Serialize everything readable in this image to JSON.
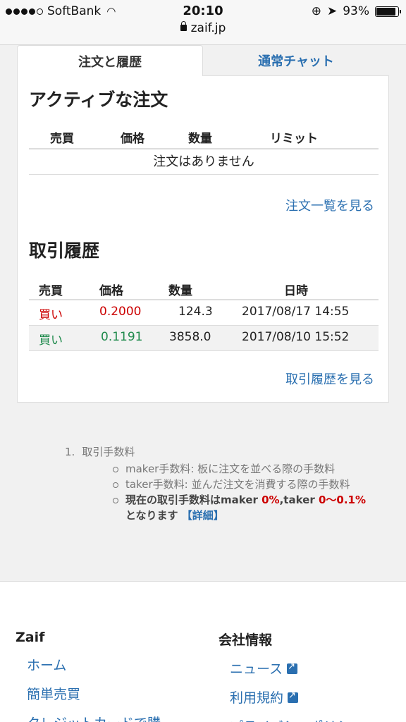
{
  "status": {
    "carrier": "SoftBank",
    "time": "20:10",
    "battery": "93%",
    "url": "zaif.jp"
  },
  "tabs": [
    {
      "label": "注文と履歴"
    },
    {
      "label": "通常チャット"
    }
  ],
  "active_orders": {
    "title": "アクティブな注文",
    "headers": [
      "売買",
      "価格",
      "数量",
      "リミット"
    ],
    "empty": "注文はありません",
    "link": "注文一覧を見る"
  },
  "history": {
    "title": "取引履歴",
    "headers": [
      "売買",
      "価格",
      "数量",
      "日時"
    ],
    "rows": [
      {
        "side": "買い",
        "price": "0.2000",
        "qty": "124.3",
        "datetime": "2017/08/17 14:55"
      },
      {
        "side": "買い",
        "price": "0.1191",
        "qty": "3858.0",
        "datetime": "2017/08/10 15:52"
      }
    ],
    "link": "取引履歴を見る"
  },
  "notes": {
    "num": "1.",
    "title": "取引手数料",
    "maker": "maker手数料: 板に注文を並べる際の手数料",
    "taker": "taker手数料: 並んだ注文を消費する際の手数料",
    "current_a": "現在の取引手数料はmaker ",
    "maker_rate": "0%",
    "current_b": ",taker ",
    "taker_rate": "0〜0.1%",
    "current_c": "となります ",
    "detail": "【詳細】"
  },
  "footer": {
    "col1": {
      "title": "Zaif",
      "links": [
        "ホーム",
        "簡単売買",
        "クレジットカードで購"
      ]
    },
    "col2": {
      "title": "会社情報",
      "links": [
        "ニュース",
        "利用規約",
        "プライバシーポリシー"
      ]
    }
  },
  "colors": {
    "link": "#2a6fb0",
    "sell": "#cc0000",
    "buy": "#1f8a4c"
  }
}
